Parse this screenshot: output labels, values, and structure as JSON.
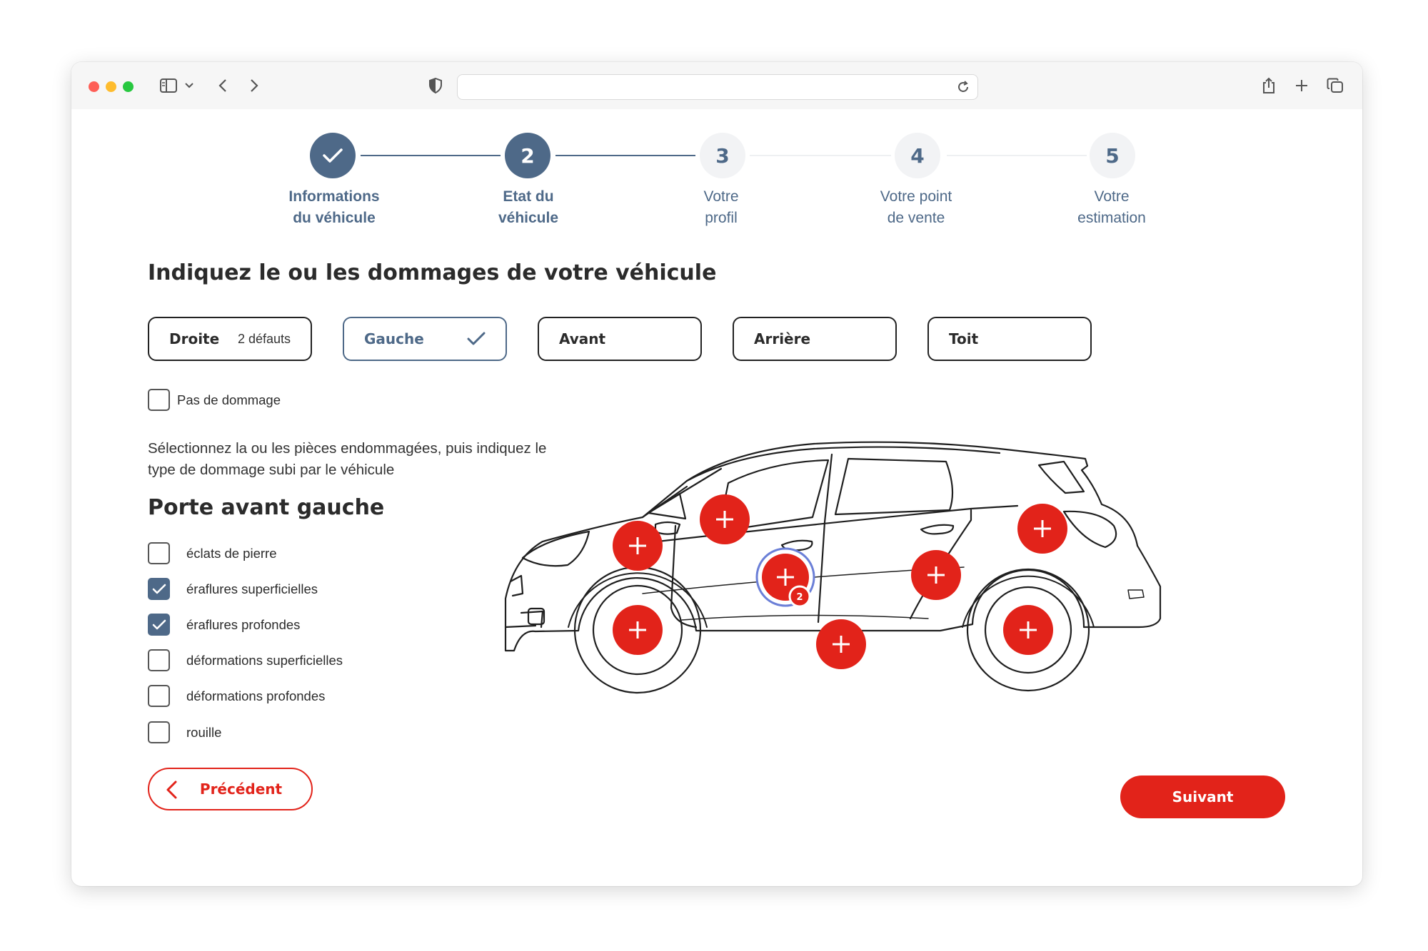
{
  "browser": {
    "address": ""
  },
  "stepper": {
    "steps": [
      {
        "number": "1",
        "label": "Informations\ndu véhicule",
        "state": "done"
      },
      {
        "number": "2",
        "label": "Etat du\nvéhicule",
        "state": "current"
      },
      {
        "number": "3",
        "label": "Votre\nprofil",
        "state": "todo"
      },
      {
        "number": "4",
        "label": "Votre point\nde vente",
        "state": "todo"
      },
      {
        "number": "5",
        "label": "Votre\nestimation",
        "state": "todo"
      }
    ]
  },
  "main": {
    "title": "Indiquez le ou les dommages de votre véhicule",
    "tabs": [
      {
        "label": "Droite",
        "count": "2 défauts",
        "selected": false
      },
      {
        "label": "Gauche",
        "selected": true
      },
      {
        "label": "Avant",
        "selected": false
      },
      {
        "label": "Arrière",
        "selected": false
      },
      {
        "label": "Toit",
        "selected": false
      }
    ],
    "no_damage": {
      "label": "Pas de dommage",
      "checked": false
    },
    "instruction": "Sélectionnez la ou les pièces endommagées, puis indiquez le type de dommage subi par le véhicule",
    "part_title": "Porte avant gauche",
    "damage_types": [
      {
        "label": "éclats de pierre",
        "checked": false
      },
      {
        "label": "éraflures superficielles",
        "checked": true
      },
      {
        "label": "éraflures profondes",
        "checked": true
      },
      {
        "label": "déformations superficielles",
        "checked": false
      },
      {
        "label": "déformations profondes",
        "checked": false
      },
      {
        "label": "rouille",
        "checked": false
      }
    ],
    "prev_label": "Précédent",
    "next_label": "Suivant"
  },
  "car": {
    "selected_badge": "2",
    "hotspots": [
      {
        "name": "hotspot-front-wheel"
      },
      {
        "name": "hotspot-hood"
      },
      {
        "name": "hotspot-front-window"
      },
      {
        "name": "hotspot-front-door"
      },
      {
        "name": "hotspot-rear-door"
      },
      {
        "name": "hotspot-sill"
      },
      {
        "name": "hotspot-rear-quarter"
      },
      {
        "name": "hotspot-rear-wheel"
      }
    ]
  },
  "colors": {
    "accent": "#e2231a",
    "primary": "#4e6988",
    "step_todo_bg": "#f2f3f5"
  }
}
